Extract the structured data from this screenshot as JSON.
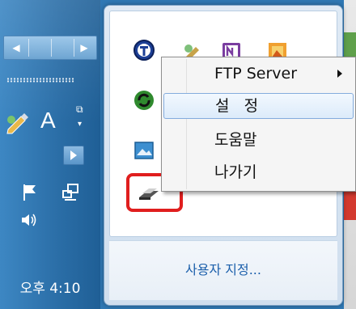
{
  "taskbar": {
    "clock": "오후 4:10",
    "language_indicator": "A",
    "icons": [
      "pen-icon",
      "flag-icon",
      "network-icon",
      "volume-icon"
    ]
  },
  "flyout": {
    "customize_link": "사용자 지정...",
    "icons": [
      "truecrypt-icon",
      "pen-icon",
      "onenote-icon",
      "image-icon",
      "sync-icon",
      "picture-icon",
      "scanner-icon"
    ]
  },
  "context_menu": {
    "items": [
      {
        "label": "FTP Server",
        "has_submenu": true
      },
      {
        "label": "설   정",
        "selected": true
      },
      {
        "label": "도움말"
      },
      {
        "label": "나가기"
      }
    ]
  },
  "colors": {
    "taskbar": "#2a6da6",
    "highlight": "#e01e1e",
    "link": "#1b5fab",
    "menu_selected_border": "#84acdd"
  }
}
